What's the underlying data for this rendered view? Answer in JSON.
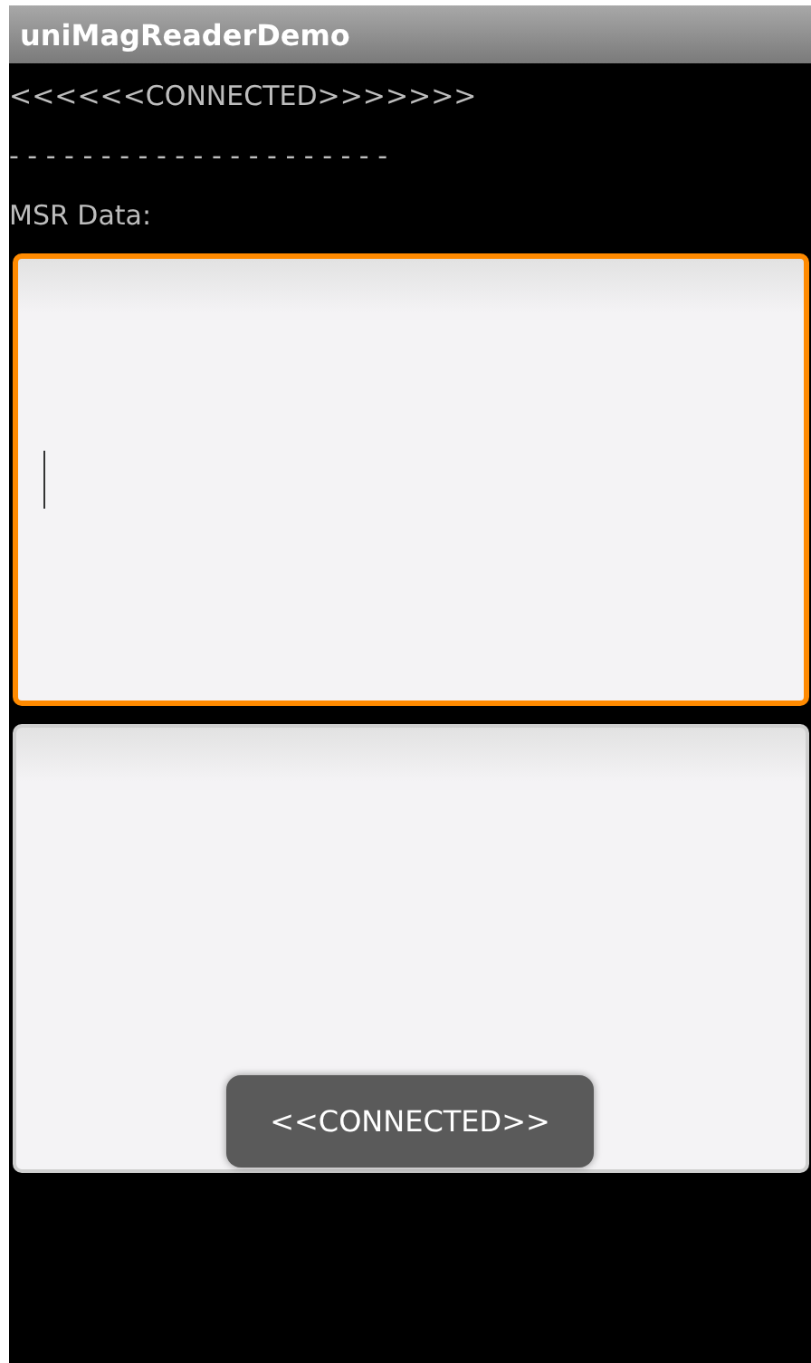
{
  "window": {
    "title": "uniMagReaderDemo"
  },
  "status": "<<<<<<CONNECTED>>>>>>>",
  "separator": "- - - - - - - - - - - - - - - - - - - - -",
  "msr_label": "MSR Data:",
  "fields": [
    {
      "focused": true
    },
    {
      "focused": false
    }
  ],
  "toast": "<<CONNECTED>>"
}
